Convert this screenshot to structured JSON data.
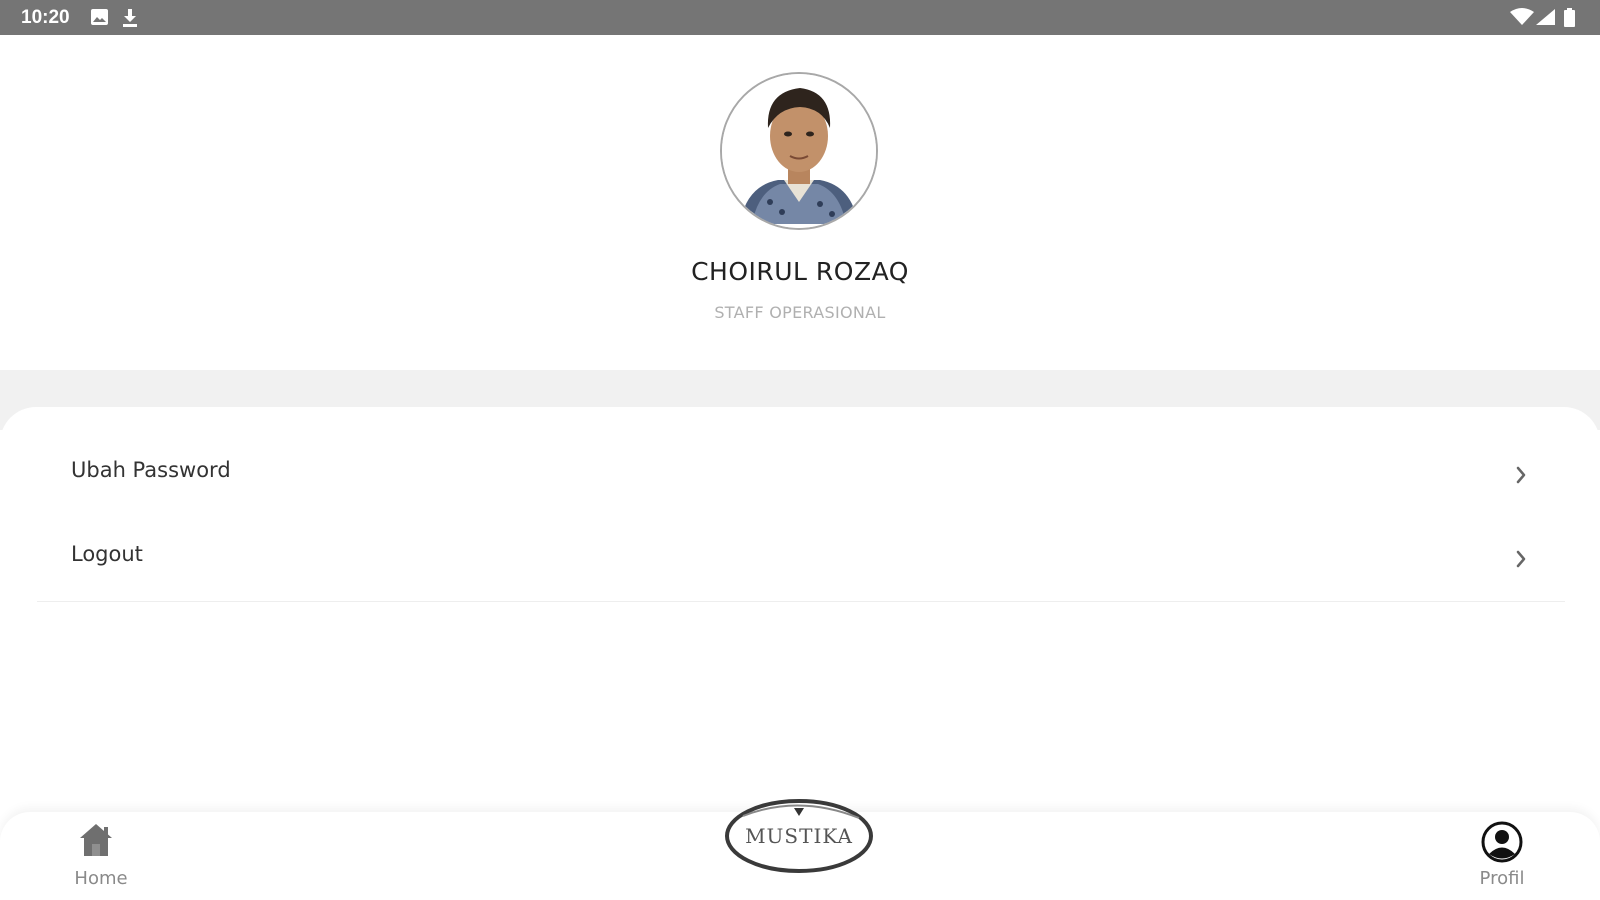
{
  "status_bar": {
    "time": "10:20",
    "left_icons": [
      "image-notification-icon",
      "download-icon"
    ],
    "right_icons": [
      "wifi-icon",
      "signal-icon",
      "battery-icon"
    ]
  },
  "profile": {
    "name": "CHOIRUL ROZAQ",
    "role": "STAFF OPERASIONAL"
  },
  "menu": {
    "items": [
      {
        "label": "Ubah Password",
        "icon": "chevron-right-icon"
      },
      {
        "label": "Logout",
        "icon": "chevron-right-icon"
      }
    ]
  },
  "bottom_nav": {
    "home_label": "Home",
    "profile_label": "Profil",
    "logo_text": "MUSTIKA"
  },
  "colors": {
    "status_bar": "#757575",
    "background": "#ffffff",
    "band": "#f1f1f1",
    "text": "#333333",
    "muted_text": "#b0b0b0"
  }
}
